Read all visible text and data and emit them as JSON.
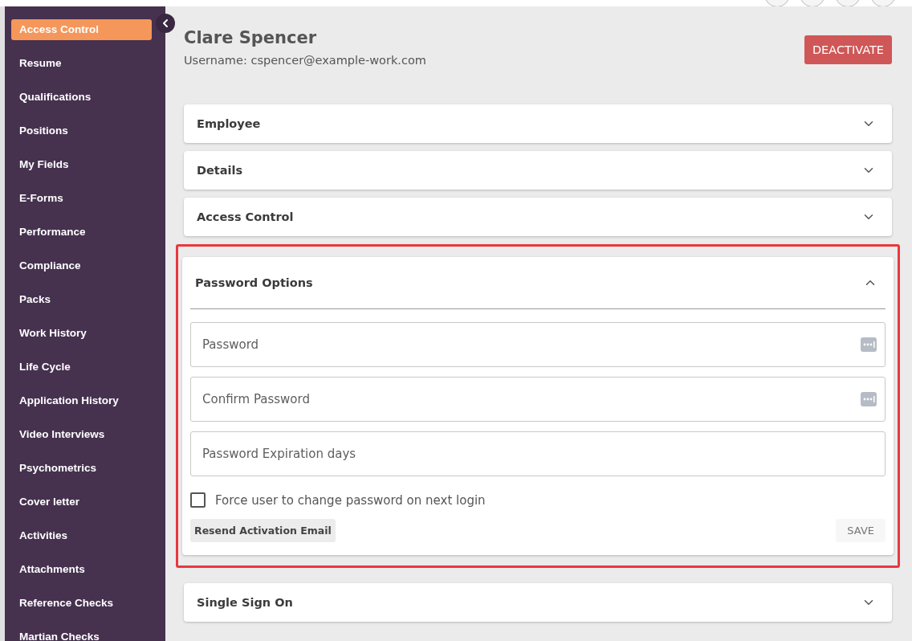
{
  "sidebar": {
    "items": [
      {
        "label": "Access Control",
        "selected": true
      },
      {
        "label": "Resume",
        "selected": false
      },
      {
        "label": "Qualifications",
        "selected": false
      },
      {
        "label": "Positions",
        "selected": false
      },
      {
        "label": "My Fields",
        "selected": false
      },
      {
        "label": "E-Forms",
        "selected": false
      },
      {
        "label": "Performance",
        "selected": false
      },
      {
        "label": "Compliance",
        "selected": false
      },
      {
        "label": "Packs",
        "selected": false
      },
      {
        "label": "Work History",
        "selected": false
      },
      {
        "label": "Life Cycle",
        "selected": false
      },
      {
        "label": "Application History",
        "selected": false
      },
      {
        "label": "Video Interviews",
        "selected": false
      },
      {
        "label": "Psychometrics",
        "selected": false
      },
      {
        "label": "Cover letter",
        "selected": false
      },
      {
        "label": "Activities",
        "selected": false
      },
      {
        "label": "Attachments",
        "selected": false
      },
      {
        "label": "Reference Checks",
        "selected": false
      },
      {
        "label": "Martian Checks",
        "selected": false
      }
    ]
  },
  "header": {
    "name": "Clare Spencer",
    "username": "Username: cspencer@example-work.com",
    "action": "DEACTIVATE"
  },
  "sections": [
    {
      "title": "Employee",
      "expanded": false,
      "highlighted": false
    },
    {
      "title": "Details",
      "expanded": false,
      "highlighted": false
    },
    {
      "title": "Access Control",
      "expanded": false,
      "highlighted": false
    },
    {
      "title": "Password Options",
      "expanded": true,
      "highlighted": true,
      "fields": [
        {
          "placeholder": "Password",
          "kind": "password"
        },
        {
          "placeholder": "Confirm Password",
          "kind": "password"
        },
        {
          "placeholder": "Password Expiration days",
          "kind": "text"
        }
      ],
      "checkbox": {
        "label": "Force user to change password on next login",
        "checked": false
      },
      "secondary_button": "Resend Activation Email",
      "save_button": "SAVE"
    },
    {
      "title": "Single Sign On",
      "expanded": false,
      "highlighted": false
    }
  ]
}
